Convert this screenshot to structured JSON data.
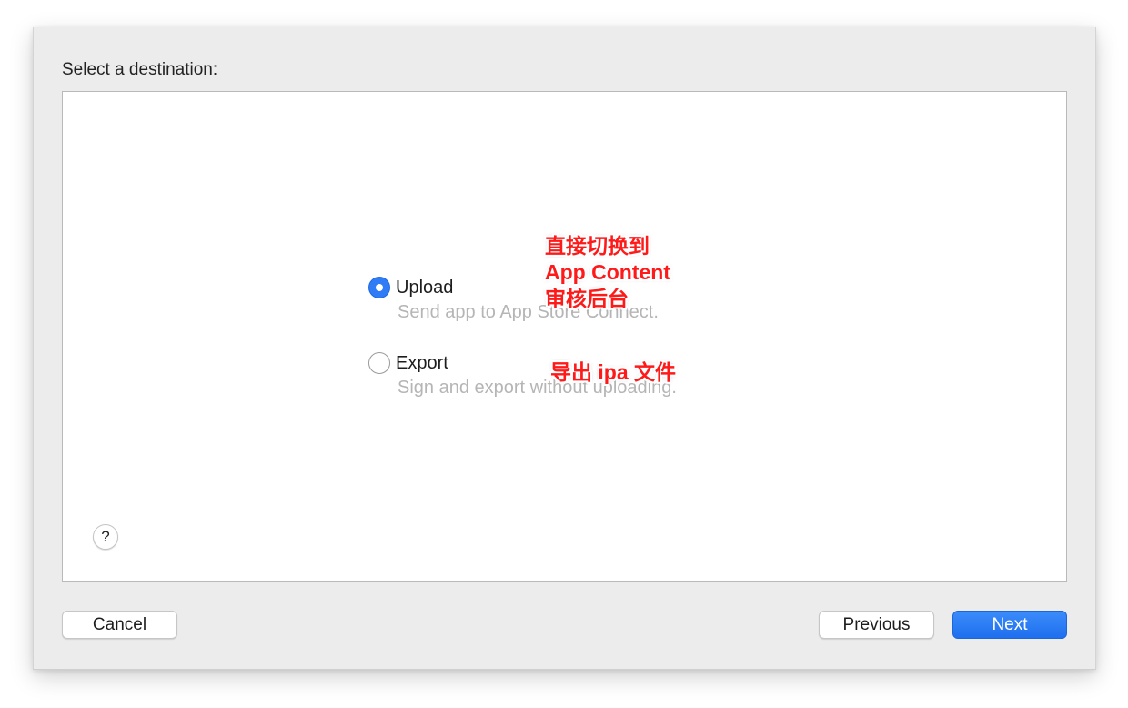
{
  "dialog": {
    "heading": "Select a destination:"
  },
  "options": [
    {
      "label": "Upload",
      "description": "Send app to App Store Connect.",
      "selected": true
    },
    {
      "label": "Export",
      "description": "Sign and export without uploading.",
      "selected": false
    }
  ],
  "annotations": {
    "upload_note": [
      "直接切换到",
      "App Content",
      "审核后台"
    ],
    "export_note": "导出 ipa 文件",
    "color": "#ff1a1a"
  },
  "help": {
    "glyph": "?"
  },
  "buttons": {
    "cancel": "Cancel",
    "previous": "Previous",
    "next": "Next"
  },
  "colors": {
    "accent": "#2f7cf6",
    "sheet_bg": "#ececec",
    "panel_bg": "#ffffff",
    "muted_text": "#b5b5b5"
  }
}
